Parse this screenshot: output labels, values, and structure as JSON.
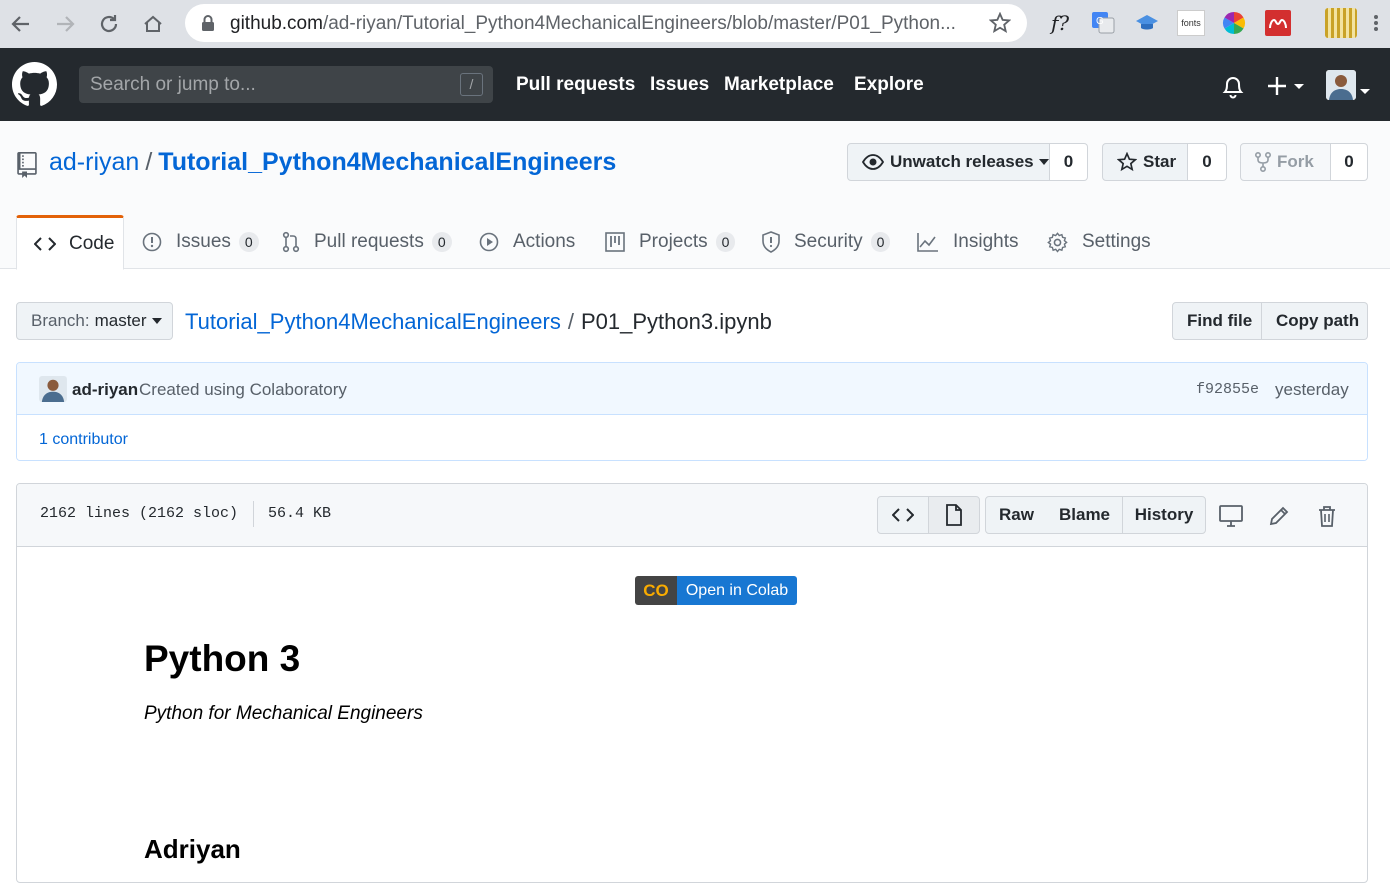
{
  "browser": {
    "url_domain": "github.com",
    "url_path": "/ad-riyan/Tutorial_Python4MechanicalEngineers/blob/master/P01_Python...",
    "ext_fonts_label": "fonts",
    "ext_f_label": "f?"
  },
  "header": {
    "search_placeholder": "Search or jump to...",
    "search_shortcut": "/",
    "nav": [
      "Pull requests",
      "Issues",
      "Marketplace",
      "Explore"
    ]
  },
  "repo": {
    "owner": "ad-riyan",
    "separator": "/",
    "name": "Tutorial_Python4MechanicalEngineers",
    "watch_label": "Unwatch releases",
    "watch_count": "0",
    "star_label": "Star",
    "star_count": "0",
    "fork_label": "Fork",
    "fork_count": "0"
  },
  "tabs": {
    "code": "Code",
    "issues": "Issues",
    "issues_count": "0",
    "pulls": "Pull requests",
    "pulls_count": "0",
    "actions": "Actions",
    "projects": "Projects",
    "projects_count": "0",
    "security": "Security",
    "security_count": "0",
    "insights": "Insights",
    "settings": "Settings"
  },
  "file_nav": {
    "branch_prefix": "Branch:",
    "branch_name": "master",
    "repo_link": "Tutorial_Python4MechanicalEngineers",
    "separator": "/",
    "file_name": "P01_Python3.ipynb",
    "find_file": "Find file",
    "copy_path": "Copy path"
  },
  "commit": {
    "author": "ad-riyan",
    "message": "Created using Colaboratory",
    "sha": "f92855e",
    "time": "yesterday",
    "contributors": "1 contributor"
  },
  "file": {
    "lines": "2162 lines (2162 sloc)",
    "size": "56.4 KB",
    "raw": "Raw",
    "blame": "Blame",
    "history": "History"
  },
  "notebook": {
    "colab_badge_logo": "CO",
    "colab_badge_text": "Open in Colab",
    "title": "Python 3",
    "subtitle": "Python for Mechanical Engineers",
    "author": "Adriyan"
  },
  "colors": {
    "header_bg": "#24292e",
    "link": "#0366d6",
    "tab_accent": "#e36209",
    "colab_orange": "#f9ab00",
    "colab_blue": "#1a73e8"
  }
}
